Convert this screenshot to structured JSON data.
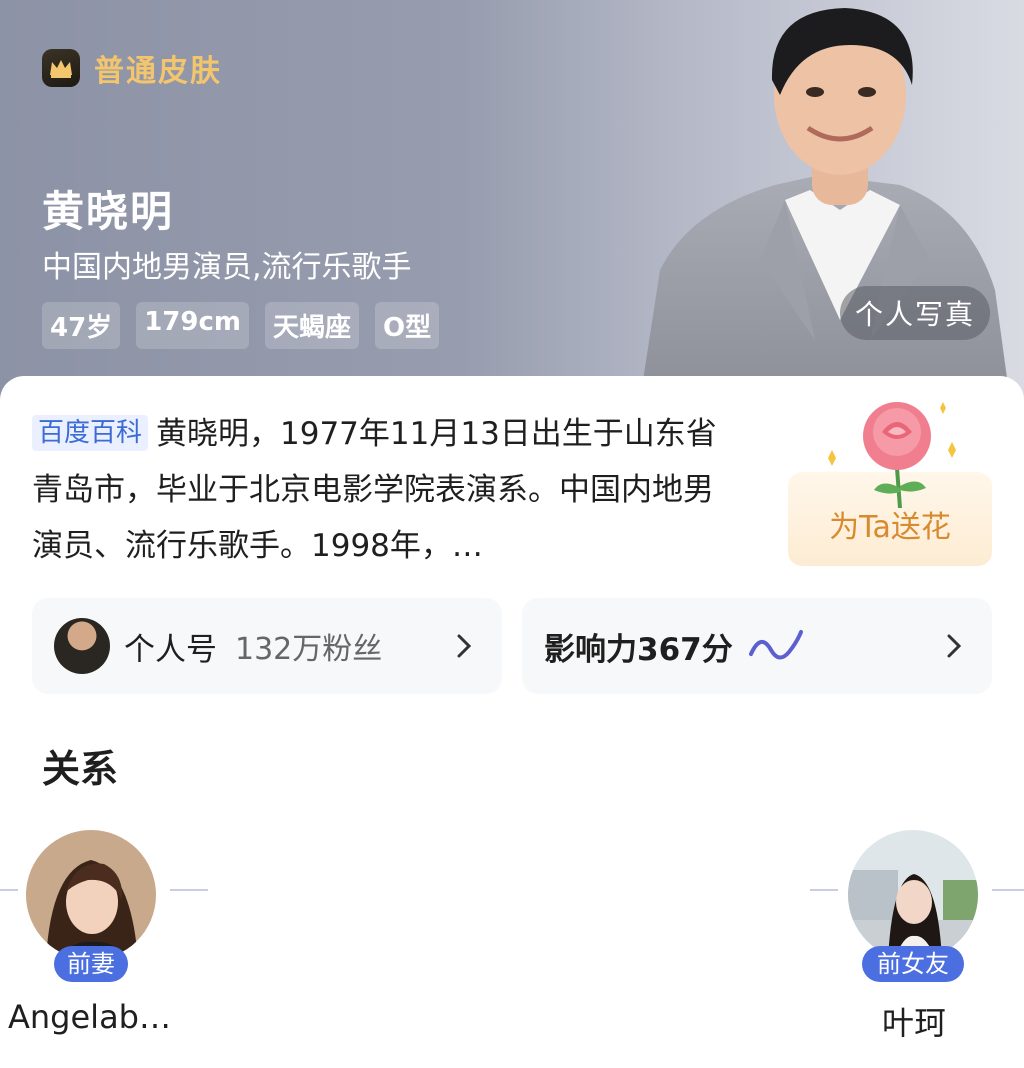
{
  "header": {
    "skin_label": "普通皮肤",
    "name": "黄晓明",
    "description": "中国内地男演员,流行乐歌手",
    "tags": [
      "47岁",
      "179cm",
      "天蝎座",
      "O型"
    ],
    "photo_button": "个人写真"
  },
  "intro": {
    "source_tag": "百度百科",
    "text": "黄晓明，1977年11月13日出生于山东省青岛市，毕业于北京电影学院表演系。中国内地男演员、流行乐歌手。1998年，…"
  },
  "flower": {
    "label": "为Ta送花"
  },
  "account": {
    "label": "个人号",
    "fans": "132万粉丝"
  },
  "influence": {
    "label": "影响力367分"
  },
  "relations": {
    "title": "关系",
    "items": [
      {
        "badge": "前妻",
        "name": "Angelab…"
      },
      {
        "badge": "前女友",
        "name": "叶珂"
      }
    ]
  },
  "colors": {
    "accent": "#4b6fe0",
    "gold": "#f3c66d",
    "flower_text": "#d88a2e"
  }
}
